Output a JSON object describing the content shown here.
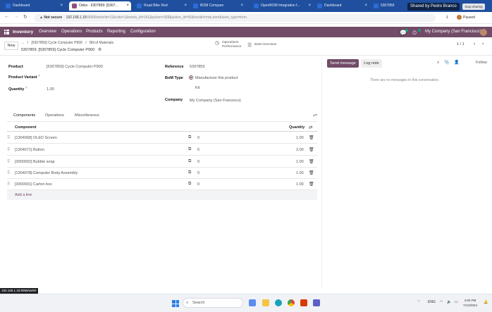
{
  "browser": {
    "tabs": [
      {
        "label": "Dashboard",
        "color": "#2b6cd6",
        "active": false
      },
      {
        "label": "Odoo - 5307859: [5307...",
        "color": "#8e4f7a",
        "active": true
      },
      {
        "label": "Road Bike Red",
        "color": "#2b6cd6",
        "active": false
      },
      {
        "label": "BOM Compare",
        "color": "#2b6cd6",
        "active": false
      },
      {
        "label": "OpenBOM Integration f...",
        "color": "#2b6cd6",
        "active": false
      },
      {
        "label": "Dashboard",
        "color": "#2b6cd6",
        "active": false
      },
      {
        "label": "5307859",
        "color": "#2b6cd6",
        "active": false
      }
    ],
    "share_banner": "Shared by Pedro Branco",
    "stop_sharing": "Stop sharing",
    "not_secure": "Not secure",
    "url_host": "192.168.1.18",
    "url_rest": ":8069/web#id=11&cids=1&menu_id=141&action=309&active_id=56&model=mrp.bom&view_type=form",
    "profile_label": "Paused"
  },
  "topnav": {
    "app_name": "Inventory",
    "menu": [
      "Overview",
      "Operations",
      "Products",
      "Reporting",
      "Configuration"
    ],
    "company": "My Company (San Francisco)"
  },
  "control": {
    "new_label": "New",
    "breadcrumb_dots": "...",
    "breadcrumb_parent": "[5307859] Cycle Computer P900",
    "breadcrumb_sep": "/",
    "breadcrumb_section": "Bill of Materials",
    "record_title": "5307859: [5307859] Cycle Computer P900",
    "smart_operations": "Operations\nPerformance",
    "smart_bom_overview": "BoM Overview",
    "pager": "1 / 1"
  },
  "form": {
    "product_label": "Product",
    "product_value": "[5307859] Cycle Computer P900",
    "variant_label": "Product Variant",
    "quantity_label": "Quantity",
    "quantity_value": "1.00",
    "reference_label": "Reference",
    "reference_value": "5307859",
    "bomtype_label": "BoM Type",
    "bomtype_option1": "Manufacture this product",
    "bomtype_option2": "Kit",
    "company_label": "Company",
    "company_value": "My Company (San Francisco)"
  },
  "tabs": [
    "Components",
    "Operations",
    "Miscellaneous"
  ],
  "table": {
    "col_component": "Component",
    "col_quantity": "Quantity",
    "rows": [
      {
        "component": "[1304068] OLED Screen",
        "op_count": "0",
        "qty": "1.00"
      },
      {
        "component": "[1304071] Button",
        "op_count": "0",
        "qty": "3.00"
      },
      {
        "component": "[3000002] Bubble wrap",
        "op_count": "0",
        "qty": "1.00"
      },
      {
        "component": "[1304078] Computer Body Assembly",
        "op_count": "0",
        "qty": "1.00"
      },
      {
        "component": "[3000001] Carton box",
        "op_count": "0",
        "qty": "1.00"
      }
    ],
    "add_line": "Add a line"
  },
  "chatter": {
    "send_message": "Send message",
    "log_note": "Log note",
    "follow": "Follow",
    "no_messages": "There are no messages in this conversation."
  },
  "statusbar": {
    "url": "192.168.1.18:8069/web#"
  },
  "taskbar": {
    "search_placeholder": "Search",
    "language": "ENG",
    "time": "4:00 PM",
    "date": "7/12/2024"
  }
}
